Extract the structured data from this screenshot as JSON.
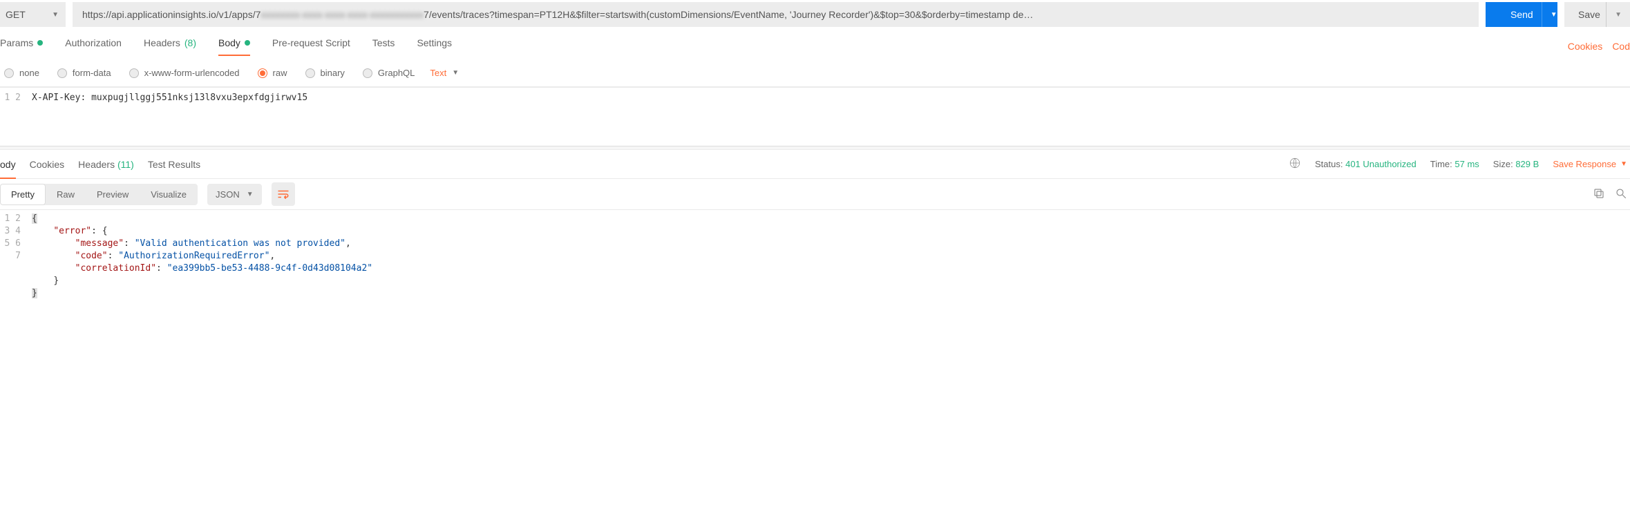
{
  "method": "GET",
  "url_prefix": "https://api.applicationinsights.io/v1/apps/7",
  "url_blurred": "xxxxxxxx-xxxx-xxxx-xxxx-xxxxxxxxxxx",
  "url_suffix": "7/events/traces?timespan=PT12H&$filter=startswith(customDimensions/EventName, 'Journey Recorder')&$top=30&$orderby=timestamp de…",
  "send_label": "Send",
  "save_label": "Save",
  "request_tabs": {
    "params": "Params",
    "authorization": "Authorization",
    "headers": "Headers",
    "headers_count": "(8)",
    "body": "Body",
    "prerequest": "Pre-request Script",
    "tests": "Tests",
    "settings": "Settings"
  },
  "right_links": {
    "cookies": "Cookies",
    "code": "Cod"
  },
  "body_types": {
    "none": "none",
    "formdata": "form-data",
    "xwww": "x-www-form-urlencoded",
    "raw": "raw",
    "binary": "binary",
    "graphql": "GraphQL"
  },
  "body_format": "Text",
  "request_body_lines": {
    "l1": "X-API-Key: muxpugjllggj551nksj13l8vxu3epxfdgjirwv15",
    "l2": ""
  },
  "response_tabs": {
    "body": "ody",
    "cookies": "Cookies",
    "headers": "Headers",
    "headers_count": "(11)",
    "testresults": "Test Results"
  },
  "status_label": "Status:",
  "status_value": "401 Unauthorized",
  "time_label": "Time:",
  "time_value": "57 ms",
  "size_label": "Size:",
  "size_value": "829 B",
  "save_response": "Save Response",
  "view_modes": {
    "pretty": "Pretty",
    "raw": "Raw",
    "preview": "Preview",
    "visualize": "Visualize"
  },
  "resp_format": "JSON",
  "resp_lines": {
    "l1_open": "{",
    "l2_key": "\"error\"",
    "l2_rest": ": {",
    "l3_key": "\"message\"",
    "l3_val": "\"Valid authentication was not provided\"",
    "l4_key": "\"code\"",
    "l4_val": "\"AuthorizationRequiredError\"",
    "l5_key": "\"correlationId\"",
    "l5_val": "\"ea399bb5-be53-4488-9c4f-0d43d08104a2\"",
    "l6": "}",
    "l7_close": "}"
  }
}
